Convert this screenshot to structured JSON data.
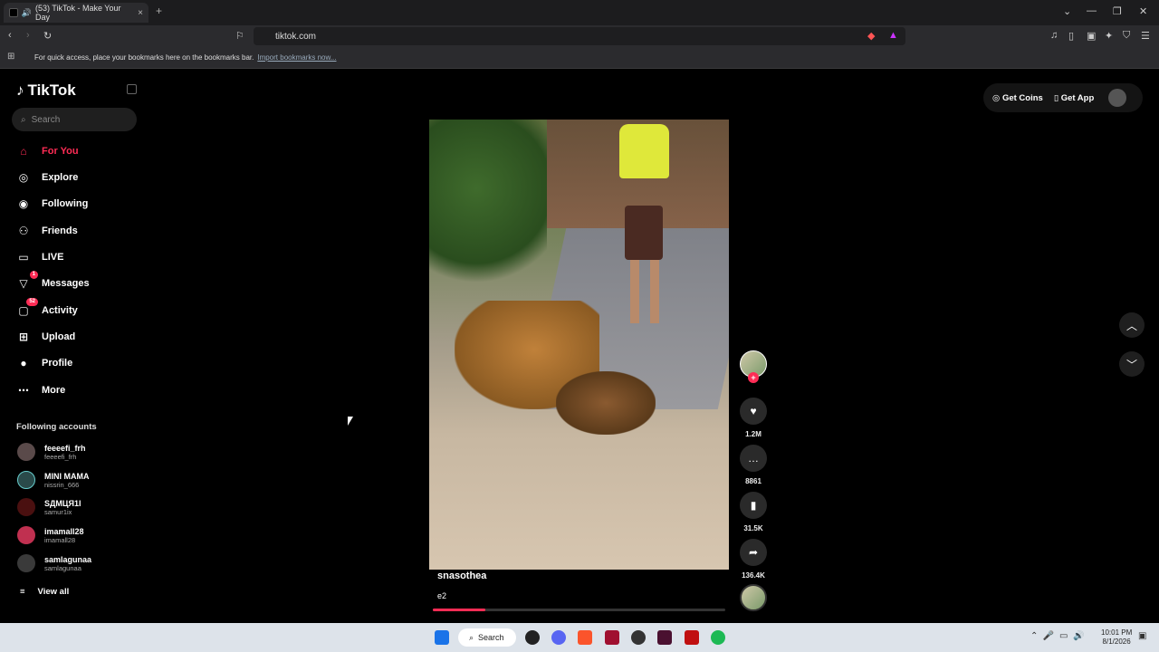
{
  "browser": {
    "tab_title": "(53) TikTok - Make Your Day",
    "url": "tiktok.com",
    "bookmarks_text": "For quick access, place your bookmarks here on the bookmarks bar.",
    "bookmarks_link": "Import bookmarks now..."
  },
  "tiktok": {
    "logo": "TikTok",
    "search_placeholder": "Search",
    "nav": [
      {
        "label": "For You",
        "icon": "home-icon"
      },
      {
        "label": "Explore",
        "icon": "compass-icon"
      },
      {
        "label": "Following",
        "icon": "following-icon"
      },
      {
        "label": "Friends",
        "icon": "friends-icon"
      },
      {
        "label": "LIVE",
        "icon": "live-icon"
      },
      {
        "label": "Messages",
        "icon": "messages-icon",
        "badge": "1"
      },
      {
        "label": "Activity",
        "icon": "activity-icon",
        "badge": "52"
      },
      {
        "label": "Upload",
        "icon": "upload-icon"
      },
      {
        "label": "Profile",
        "icon": "profile-icon"
      },
      {
        "label": "More",
        "icon": "more-icon"
      }
    ],
    "following_title": "Following accounts",
    "accounts": [
      {
        "name": "feeeefi_frh",
        "handle": "feeeefi_frh"
      },
      {
        "name": "MINI MAMA",
        "handle": "nissrin_666"
      },
      {
        "name": "ЅДМЦЯ1І",
        "handle": "samur1ix"
      },
      {
        "name": "imamall28",
        "handle": "imamall28"
      },
      {
        "name": "samlagunaa",
        "handle": "samlagunaa"
      }
    ],
    "view_all": "View all",
    "get_coins": "Get Coins",
    "get_app": "Get App",
    "video": {
      "username": "snasothea",
      "description": "e2",
      "progress": 0.18
    },
    "actions": {
      "likes": "1.2M",
      "comments": "8861",
      "saves": "31.5K",
      "shares": "136.4K"
    }
  },
  "taskbar": {
    "search": "Search",
    "time": "10:01 PM",
    "date": "8/1/2026"
  }
}
